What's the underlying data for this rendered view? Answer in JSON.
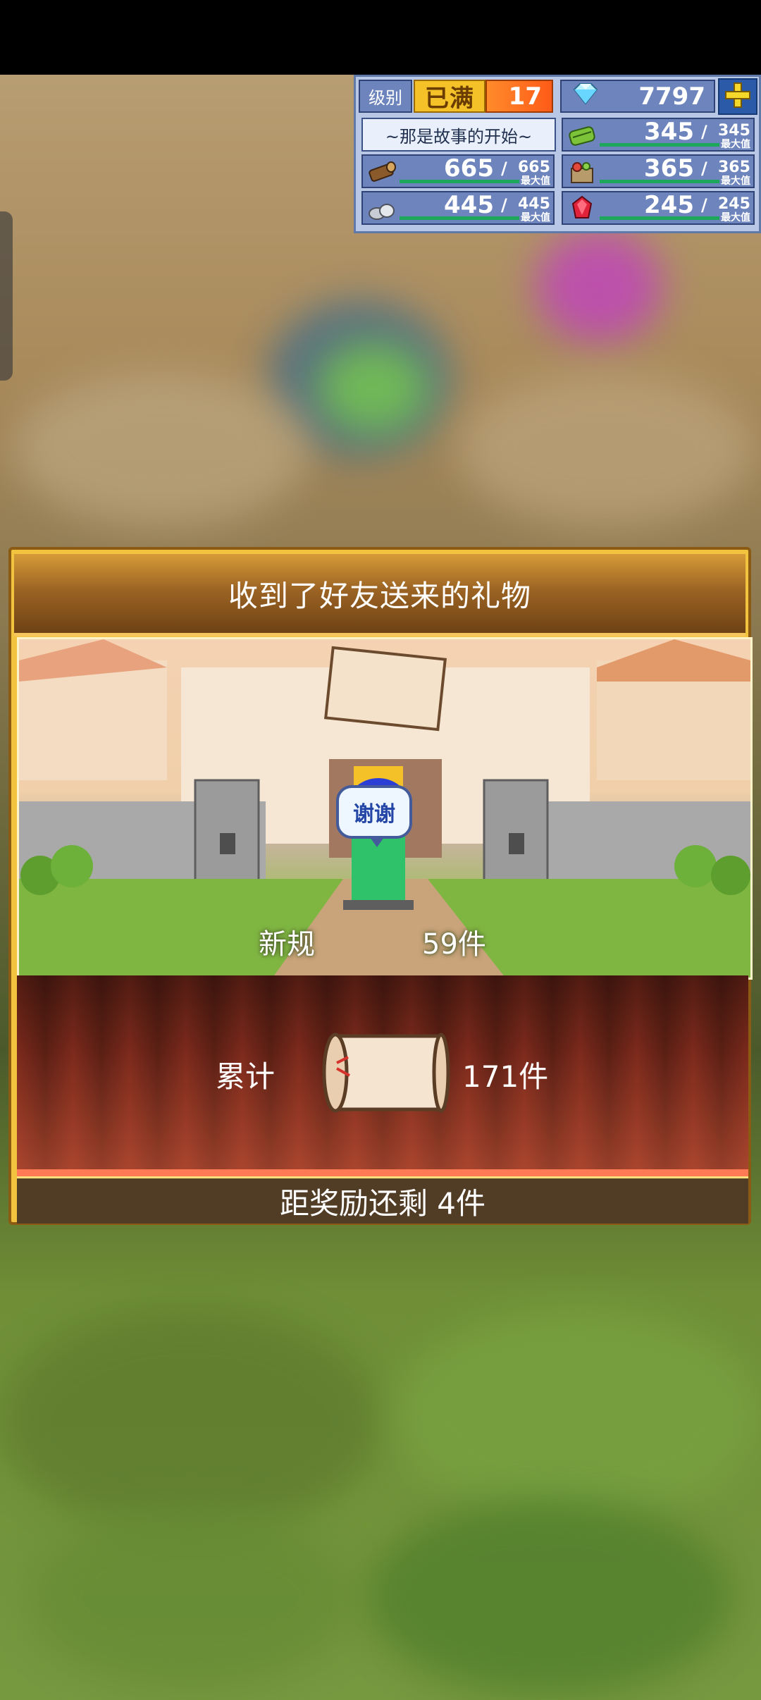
{
  "hud": {
    "level_label": "级别",
    "level_status": "已满",
    "level": "17",
    "gems": "7797",
    "story_title": "~那是故事的开始~",
    "max_label": "最大值",
    "resources": [
      {
        "name": "wood",
        "current": "665",
        "max": "665"
      },
      {
        "name": "stone",
        "current": "445",
        "max": "445"
      },
      {
        "name": "grass",
        "current": "345",
        "max": "345"
      },
      {
        "name": "food",
        "current": "365",
        "max": "365"
      },
      {
        "name": "ruby",
        "current": "245",
        "max": "245"
      }
    ]
  },
  "dialog": {
    "title": "收到了好友送来的礼物",
    "speech": "谢谢",
    "new_label": "新规",
    "new_count": "59件",
    "total_label": "累计",
    "total_count": "171件",
    "reward_text": "距奖励还剩 4件"
  },
  "colors": {
    "dialog_border": "#f2c33f",
    "hud_bg": "#6d84bd",
    "curtain": "#7d2a1c",
    "reward_bar": "#513c26"
  }
}
